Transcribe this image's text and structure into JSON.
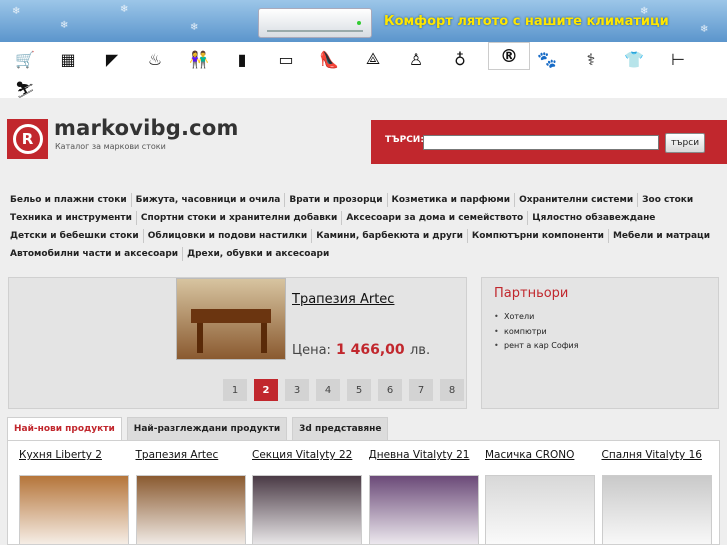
{
  "banner": {
    "text": "Комфорт лятото с нашите климатици"
  },
  "category_icons": [
    {
      "name": "cart-icon",
      "glyph": "🛒"
    },
    {
      "name": "building-icon",
      "glyph": "▦"
    },
    {
      "name": "camera-icon",
      "glyph": "◤"
    },
    {
      "name": "sauna-icon",
      "glyph": "♨"
    },
    {
      "name": "people-icon",
      "glyph": "👫"
    },
    {
      "name": "door-icon",
      "glyph": "▮"
    },
    {
      "name": "car-icon",
      "glyph": "▭"
    },
    {
      "name": "shoe-icon",
      "glyph": "👠"
    },
    {
      "name": "tripod-icon",
      "glyph": "⟁"
    },
    {
      "name": "chair-icon",
      "glyph": "♙"
    },
    {
      "name": "pendant-icon",
      "glyph": "♁"
    },
    {
      "name": "armchair-icon",
      "glyph": "♜"
    },
    {
      "name": "registered-icon",
      "glyph": "®"
    },
    {
      "name": "paw-icon",
      "glyph": "🐾"
    },
    {
      "name": "caduceus-icon",
      "glyph": "⚕"
    },
    {
      "name": "tshirt-icon",
      "glyph": "👕"
    },
    {
      "name": "doorhandle-icon",
      "glyph": "⊢"
    },
    {
      "name": "runner-icon",
      "glyph": "⛷"
    }
  ],
  "logo": {
    "mark": "R",
    "title": "markovibg.com",
    "subtitle": "Каталог за маркови стоки"
  },
  "search": {
    "label": "ТЪРСИ:",
    "value": "",
    "button": "търси"
  },
  "categories": [
    [
      "Бельо и плажни стоки",
      "Бижута, часовници и очила",
      "Врати и прозорци",
      "Козметика и парфюми",
      "Охранителни системи",
      "Зоо стоки"
    ],
    [
      "Техника и инструменти",
      "Спортни стоки и хранителни добавки",
      "Аксесоари за дома и семейството",
      "Цялостно обзавеждане"
    ],
    [
      "Детски и бебешки стоки",
      "Облицовки и подови настилки",
      "Камини, барбекюта и други",
      "Компютърни компоненти",
      "Мебели и матраци"
    ],
    [
      "Автомобилни части и аксесоари",
      "Дрехи, обувки и аксесоари"
    ]
  ],
  "featured": {
    "title": "Трапезия Artec",
    "price_label": "Цена:",
    "price": "1 466,00",
    "currency": "лв.",
    "pages": [
      "1",
      "2",
      "3",
      "4",
      "5",
      "6",
      "7",
      "8"
    ],
    "active_page": "2"
  },
  "partners": {
    "title": "Партньори",
    "links": [
      "Хотели",
      "компютри",
      "рент а кар София"
    ]
  },
  "tabs": [
    "Най-нови продукти",
    "Най-разглеждани продукти",
    "3d представяне"
  ],
  "products": [
    {
      "name": "Кухня Liberty 2",
      "color": "#b5753a"
    },
    {
      "name": "Трапезия Artec",
      "color": "#8a5a30"
    },
    {
      "name": "Секция Vitalyty 22",
      "color": "#4a3a45"
    },
    {
      "name": "Дневна Vitalyty 21",
      "color": "#6b4a78"
    },
    {
      "name": "Масичка CRONO",
      "color": "#d8d8d8"
    },
    {
      "name": "Спалня Vitalyty 16",
      "color": "#c9c9c9"
    }
  ]
}
